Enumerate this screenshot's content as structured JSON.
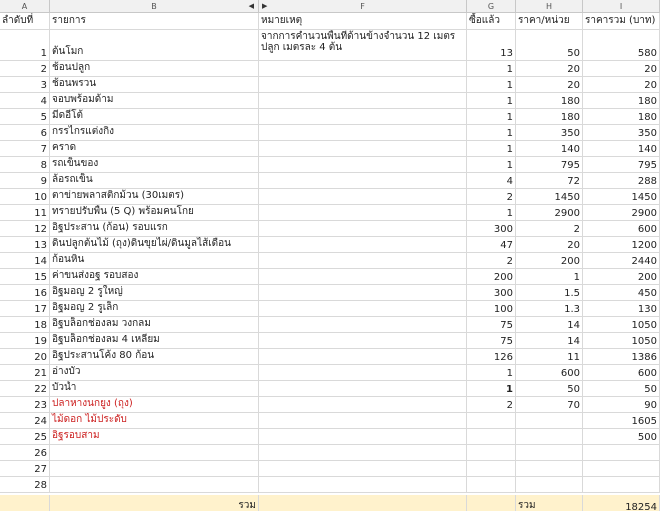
{
  "sheet": {
    "columns": [
      "A",
      "B",
      "F",
      "G",
      "H",
      "I"
    ],
    "headers": {
      "order": "ลำดับที่",
      "item": "รายการ",
      "note": "หมายเหตุ",
      "bought": "ซื้อแล้ว",
      "unit_price": "ราคา/หน่วย",
      "total_price": "ราคารวม (บาท)"
    },
    "note_row1": "จากการคำนวนพื้นที่ด้านข้างจำนวน 12 เมตร ปลูก เมตรละ 4  ต้น",
    "rows": [
      {
        "no": "1",
        "item": "ต้นโมก",
        "qty": "13",
        "price": "50",
        "total": "580"
      },
      {
        "no": "2",
        "item": "ช้อนปลูก",
        "qty": "1",
        "price": "20",
        "total": "20"
      },
      {
        "no": "3",
        "item": "ช้อนพรวน",
        "qty": "1",
        "price": "20",
        "total": "20"
      },
      {
        "no": "4",
        "item": "จอบพร้อมด้าม",
        "qty": "1",
        "price": "180",
        "total": "180"
      },
      {
        "no": "5",
        "item": "มีดอีโต้",
        "qty": "1",
        "price": "180",
        "total": "180"
      },
      {
        "no": "6",
        "item": "กรรไกรแต่งกิ่ง",
        "qty": "1",
        "price": "350",
        "total": "350"
      },
      {
        "no": "7",
        "item": "คราด",
        "qty": "1",
        "price": "140",
        "total": "140"
      },
      {
        "no": "8",
        "item": "รถเข็นของ",
        "qty": "1",
        "price": "795",
        "total": "795"
      },
      {
        "no": "9",
        "item": "ล้อรถเข็น",
        "qty": "4",
        "price": "72",
        "total": "288"
      },
      {
        "no": "10",
        "item": "ตาข่ายพลาสติกม้วน (30เมตร)",
        "qty": "2",
        "price": "1450",
        "total": "1450"
      },
      {
        "no": "11",
        "item": "ทรายปรับพื้น (5 Q) พร้อมคนโกย",
        "qty": "1",
        "price": "2900",
        "total": "2900"
      },
      {
        "no": "12",
        "item": "อิฐประสาน (ก้อน) รอบแรก",
        "qty": "300",
        "price": "2",
        "total": "600"
      },
      {
        "no": "13",
        "item": "ดินปลูกต้นไม้ (ถุง)ดินขุยไผ่/ดินมูลไส้เดือน",
        "qty": "47",
        "price": "20",
        "total": "1200"
      },
      {
        "no": "14",
        "item": "ก้อนหิน",
        "qty": "2",
        "price": "200",
        "total": "2440"
      },
      {
        "no": "15",
        "item": "ค่าขนส่งอฐ รอบสอง",
        "qty": "200",
        "price": "1",
        "total": "200"
      },
      {
        "no": "16",
        "item": "อิฐมอญ 2 รูใหญ่",
        "qty": "300",
        "price": "1.5",
        "total": "450"
      },
      {
        "no": "17",
        "item": "อิฐมอญ 2 รูเล็ก",
        "qty": "100",
        "price": "1.3",
        "total": "130"
      },
      {
        "no": "18",
        "item": "อิฐบล็อกช่องลม วงกลม",
        "qty": "75",
        "price": "14",
        "total": "1050"
      },
      {
        "no": "19",
        "item": "อิฐบล็อกช่องลม 4 เหลี่ยม",
        "qty": "75",
        "price": "14",
        "total": "1050"
      },
      {
        "no": "20",
        "item": "อิฐประสานโค้ง  80  ก้อน",
        "qty": "126",
        "price": "11",
        "total": "1386"
      },
      {
        "no": "21",
        "item": "อ่างบัว",
        "qty": "1",
        "price": "600",
        "total": "600"
      },
      {
        "no": "22",
        "item": "บัวน้ำ",
        "qty": "1",
        "price": "50",
        "total": "50"
      },
      {
        "no": "23",
        "item": "ปลาหางนกยูง (ถุง)",
        "qty": "2",
        "price": "70",
        "total": "90"
      },
      {
        "no": "24",
        "item": "ไม้ดอก ไม้ประดับ",
        "qty": "",
        "price": "",
        "total": "1605"
      },
      {
        "no": "25",
        "item": "อิฐรอบสาม",
        "qty": "",
        "price": "",
        "total": "500"
      },
      {
        "no": "26",
        "item": "",
        "qty": "",
        "price": "",
        "total": ""
      },
      {
        "no": "27",
        "item": "",
        "qty": "",
        "price": "",
        "total": ""
      },
      {
        "no": "28",
        "item": "",
        "qty": "",
        "price": "",
        "total": ""
      }
    ],
    "red_item_rows": [
      23,
      24,
      25
    ],
    "bold_qty_rows": [
      22
    ],
    "total_row": {
      "label_b": "รวม",
      "label_h": "รวม",
      "value": "18254"
    },
    "colors": {
      "header_bg": "#f1f1f1",
      "grid_line": "#d9d9d9",
      "total_bg": "#fff2cc",
      "red_text": "#cc1f1f"
    }
  }
}
